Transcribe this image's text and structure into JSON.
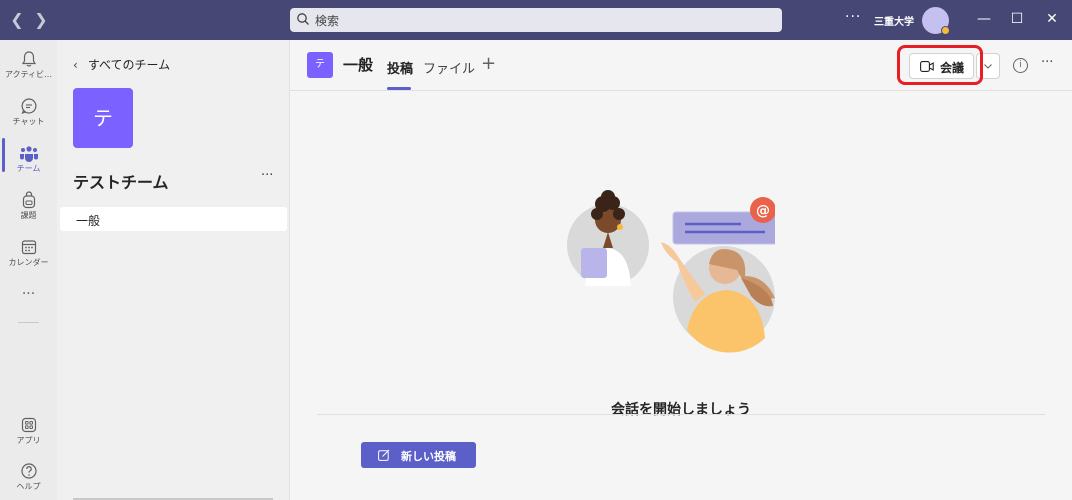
{
  "titlebar": {
    "back_icon": "chevron-left-icon",
    "forward_icon": "chevron-right-icon",
    "search_placeholder": "検索",
    "more": "···",
    "org_name": "三重大学",
    "window_controls": {
      "minimize": "—",
      "maximize": "☐",
      "close": "✕"
    }
  },
  "rail": {
    "items": [
      {
        "label": "アクティビ…",
        "icon": "bell-icon"
      },
      {
        "label": "チャット",
        "icon": "chat-icon"
      },
      {
        "label": "チーム",
        "icon": "teams-icon",
        "active": true
      },
      {
        "label": "課題",
        "icon": "backpack-icon"
      },
      {
        "label": "カレンダー",
        "icon": "calendar-icon"
      },
      {
        "label": "···",
        "icon": "more-icon"
      }
    ],
    "bottom": [
      {
        "label": "アプリ",
        "icon": "apps-icon"
      },
      {
        "label": "ヘルプ",
        "icon": "help-icon"
      }
    ]
  },
  "team_panel": {
    "back_label": "すべてのチーム",
    "team_initial": "テ",
    "team_name": "テストチーム",
    "more": "···",
    "channels": [
      {
        "label": "一般",
        "selected": true
      }
    ]
  },
  "channel_header": {
    "initial": "テ",
    "title": "一般",
    "tabs": [
      {
        "label": "投稿",
        "active": true
      },
      {
        "label": "ファイル",
        "active": false
      }
    ],
    "add_tab": "+",
    "meet_label": "会議",
    "info": "i",
    "more": "···"
  },
  "main": {
    "empty_title": "会話を開始しましょう",
    "new_post_label": "新しい投稿"
  },
  "colors": {
    "titlebar": "#464775",
    "accent": "#5b5fc7",
    "team_tile": "#7b61ff",
    "highlight_box": "#e81e25"
  }
}
